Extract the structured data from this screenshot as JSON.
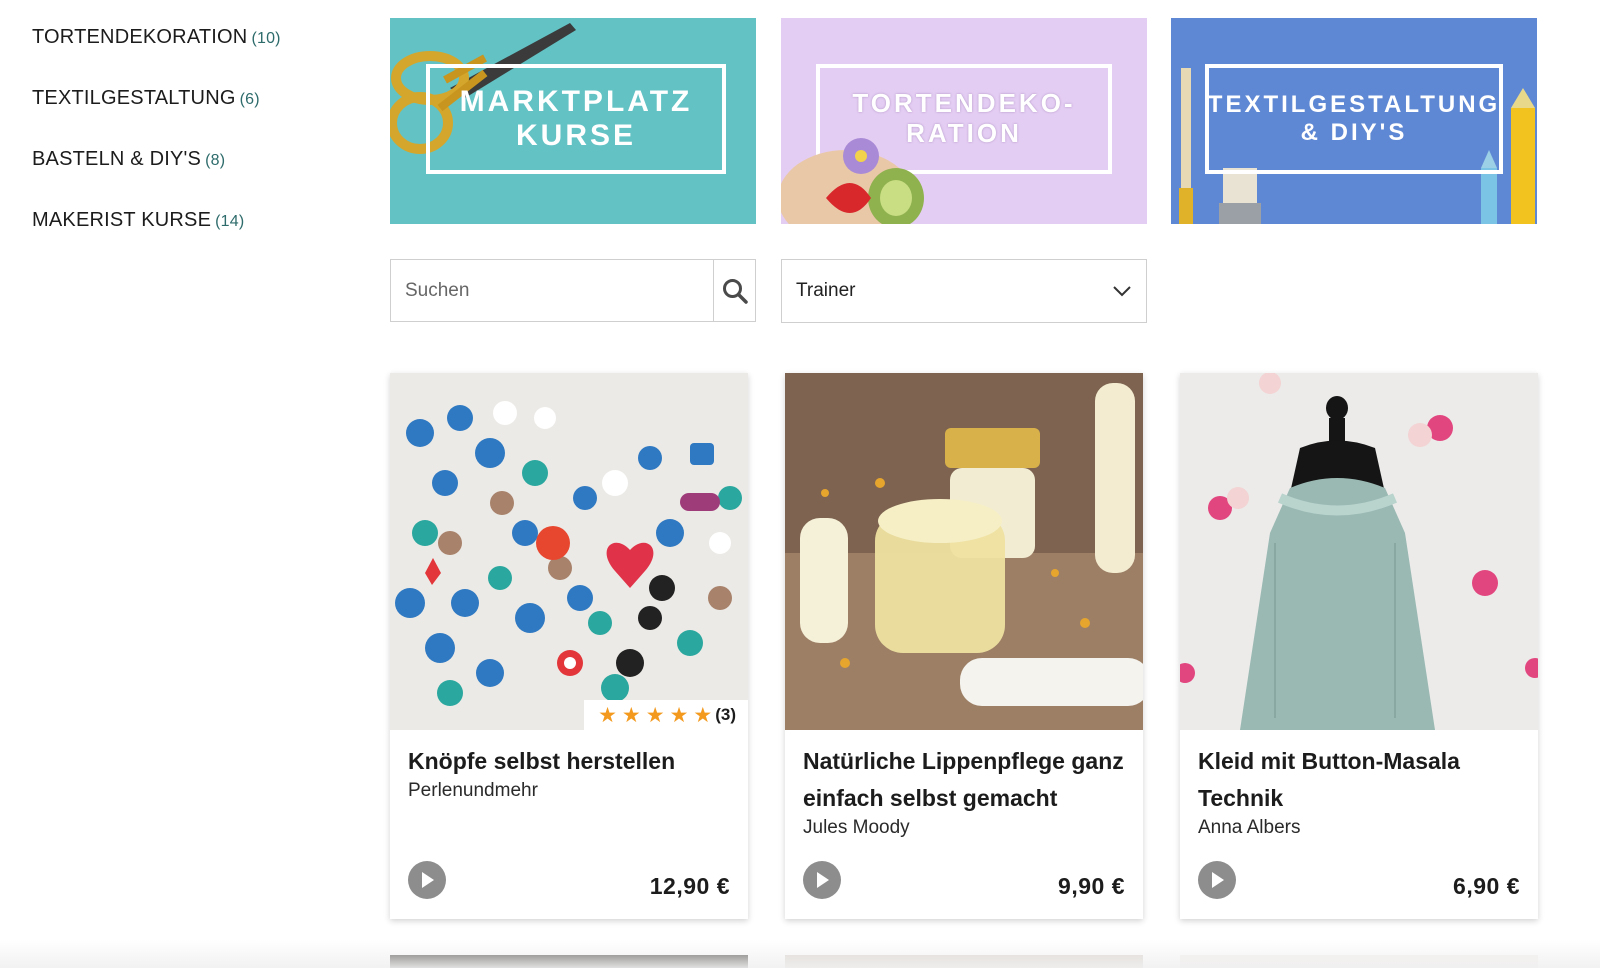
{
  "sidebar": {
    "categories": [
      {
        "label": "TORTENDEKORATION",
        "count": "(10)"
      },
      {
        "label": "TEXTILGESTALTUNG",
        "count": "(6)"
      },
      {
        "label": "BASTELN & DIY'S",
        "count": "(8)"
      },
      {
        "label": "MAKERIST KURSE",
        "count": "(14)"
      }
    ]
  },
  "banners": [
    {
      "line1": "MARKTPLATZ",
      "line2": "KURSE",
      "bg": "#62c2c4"
    },
    {
      "line1": "TORTENDEKO-",
      "line2": "RATION",
      "bg": "#e4cdf3"
    },
    {
      "line1": "TEXTILGESTALTUNG",
      "line2": "& DIY'S",
      "bg": "#5f88d4"
    }
  ],
  "filters": {
    "search_placeholder": "Suchen",
    "search_icon": "magnifier-icon",
    "trainer_select": "Trainer",
    "select_icon": "chevron-down-icon"
  },
  "products": [
    {
      "title": "Knöpfe selbst herstellen",
      "author": "Perlenundmehr",
      "price": "12,90 €",
      "rating_stars": 5,
      "rating_count": "(3)"
    },
    {
      "title": "Natürliche Lippenpflege ganz einfach selbst gemacht",
      "author": "Jules Moody",
      "price": "9,90 €"
    },
    {
      "title": "Kleid mit Button-Masala Technik",
      "author": "Anna Albers",
      "price": "6,90 €"
    }
  ],
  "colors": {
    "accent_star": "#f39a1e",
    "count_text": "#2e6b6b",
    "play_button": "#8d8d8d"
  }
}
